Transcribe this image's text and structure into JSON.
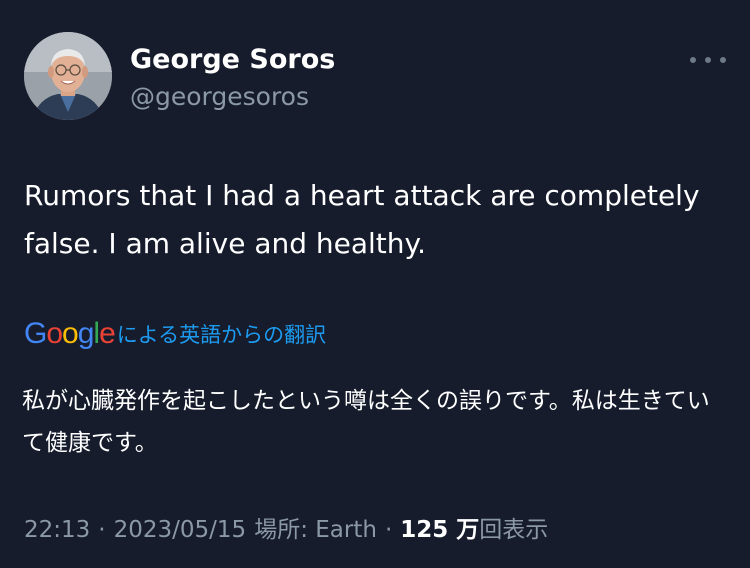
{
  "author": {
    "name": "George Soros",
    "handle": "@georgesoros",
    "avatar_icon": "profile-photo"
  },
  "more_icon": "more-horizontal-icon",
  "tweet": {
    "text": "Rumors that I had a heart attack are completely false. I am alive and healthy."
  },
  "translation": {
    "logo_letters": [
      {
        "ch": "G",
        "color": "#4285F4"
      },
      {
        "ch": "o",
        "color": "#EA4335"
      },
      {
        "ch": "o",
        "color": "#FBBC05"
      },
      {
        "ch": "g",
        "color": "#4285F4"
      },
      {
        "ch": "l",
        "color": "#34A853"
      },
      {
        "ch": "e",
        "color": "#EA4335"
      }
    ],
    "label": "による英語からの翻訳",
    "text": "私が心臓発作を起こしたという噂は全くの誤りです。私は生きていて健康です。"
  },
  "meta": {
    "time": "22:13",
    "separator": "·",
    "date": "2023/05/15",
    "location": "場所: Earth",
    "views_count": "125 万",
    "views_label": "回表示"
  },
  "colors": {
    "background": "#161c2c",
    "secondary_text": "#8b98a5",
    "link": "#1d9bf0"
  }
}
